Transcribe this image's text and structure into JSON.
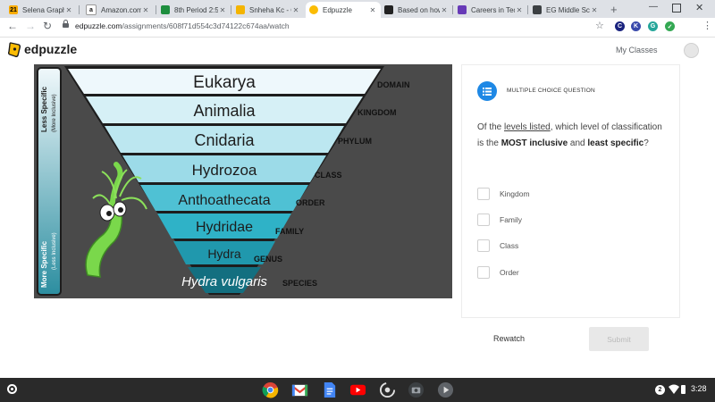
{
  "browser": {
    "tabs": [
      {
        "label": "Selena Graphi",
        "icon": "grade-icon",
        "icon_text": "21",
        "icon_color": "#f9ab00"
      },
      {
        "label": "Amazon.com",
        "icon": "amazon-icon",
        "icon_text": "a",
        "icon_color": "#111111"
      },
      {
        "label": "8th Period 2:5",
        "icon": "classroom-icon",
        "icon_text": "",
        "icon_color": "#1e8e3e"
      },
      {
        "label": "Snheha Kc - Cl",
        "icon": "slides-icon",
        "icon_text": "",
        "icon_color": "#f4b400"
      },
      {
        "label": "Edpuzzle",
        "icon": "edpuzzle-icon",
        "icon_text": "",
        "icon_color": "#fbbc04"
      },
      {
        "label": "Based on how",
        "icon": "brainly-icon",
        "icon_text": "",
        "icon_color": "#222222"
      },
      {
        "label": "Careers in Tec",
        "icon": "forms-icon",
        "icon_text": "",
        "icon_color": "#673ab7"
      },
      {
        "label": "EG Middle Sch",
        "icon": "school-icon",
        "icon_text": "",
        "icon_color": "#3c4043"
      }
    ],
    "active_tab_index": 4,
    "url_host": "edpuzzle.com",
    "url_path": "/assignments/608f71d554c3d74122c674aa/watch",
    "extensions": [
      {
        "name": "c-extension-icon",
        "label": "C",
        "color": "#1a237e"
      },
      {
        "name": "k-extension-icon",
        "label": "K",
        "color": "#3949ab"
      },
      {
        "name": "g-extension-icon",
        "label": "G",
        "color": "#26a69a"
      },
      {
        "name": "check-extension-icon",
        "label": "✓",
        "color": "#34a853"
      }
    ]
  },
  "header": {
    "logo_text": "edpuzzle",
    "my_classes": "My Classes"
  },
  "diagram": {
    "ranks": [
      {
        "taxon": "Eukarya",
        "rank": "DOMAIN"
      },
      {
        "taxon": "Animalia",
        "rank": "KINGDOM"
      },
      {
        "taxon": "Cnidaria",
        "rank": "PHYLUM"
      },
      {
        "taxon": "Hydrozoa",
        "rank": "CLASS"
      },
      {
        "taxon": "Anthoathecata",
        "rank": "ORDER"
      },
      {
        "taxon": "Hydridae",
        "rank": "FAMILY"
      },
      {
        "taxon": "Hydra",
        "rank": "GENUS"
      },
      {
        "taxon": "Hydra vulgaris",
        "rank": "SPECIES"
      }
    ],
    "less_specific": "Less Specific",
    "more_inclusive": "(More Inclusive)",
    "more_specific": "More Specific",
    "less_inclusive": "(Less Inclusive)"
  },
  "question": {
    "type_label": "MULTIPLE CHOICE QUESTION",
    "text_1": "Of the ",
    "text_underlined": "levels listed",
    "text_2": ", which level of classification  is the ",
    "text_bold_1": "MOST inclusive",
    "text_3": " and ",
    "text_bold_2": "least specific",
    "text_4": "?",
    "options": [
      "Kingdom",
      "Family",
      "Class",
      "Order"
    ],
    "rewatch_label": "Rewatch",
    "submit_label": "Submit"
  },
  "shelf": {
    "apps": [
      "chrome-icon",
      "gmail-icon",
      "docs-icon",
      "youtube-icon",
      "screen-recorder-icon",
      "camera-icon",
      "play-icon"
    ],
    "notification_count": "2",
    "time": "3:28"
  }
}
